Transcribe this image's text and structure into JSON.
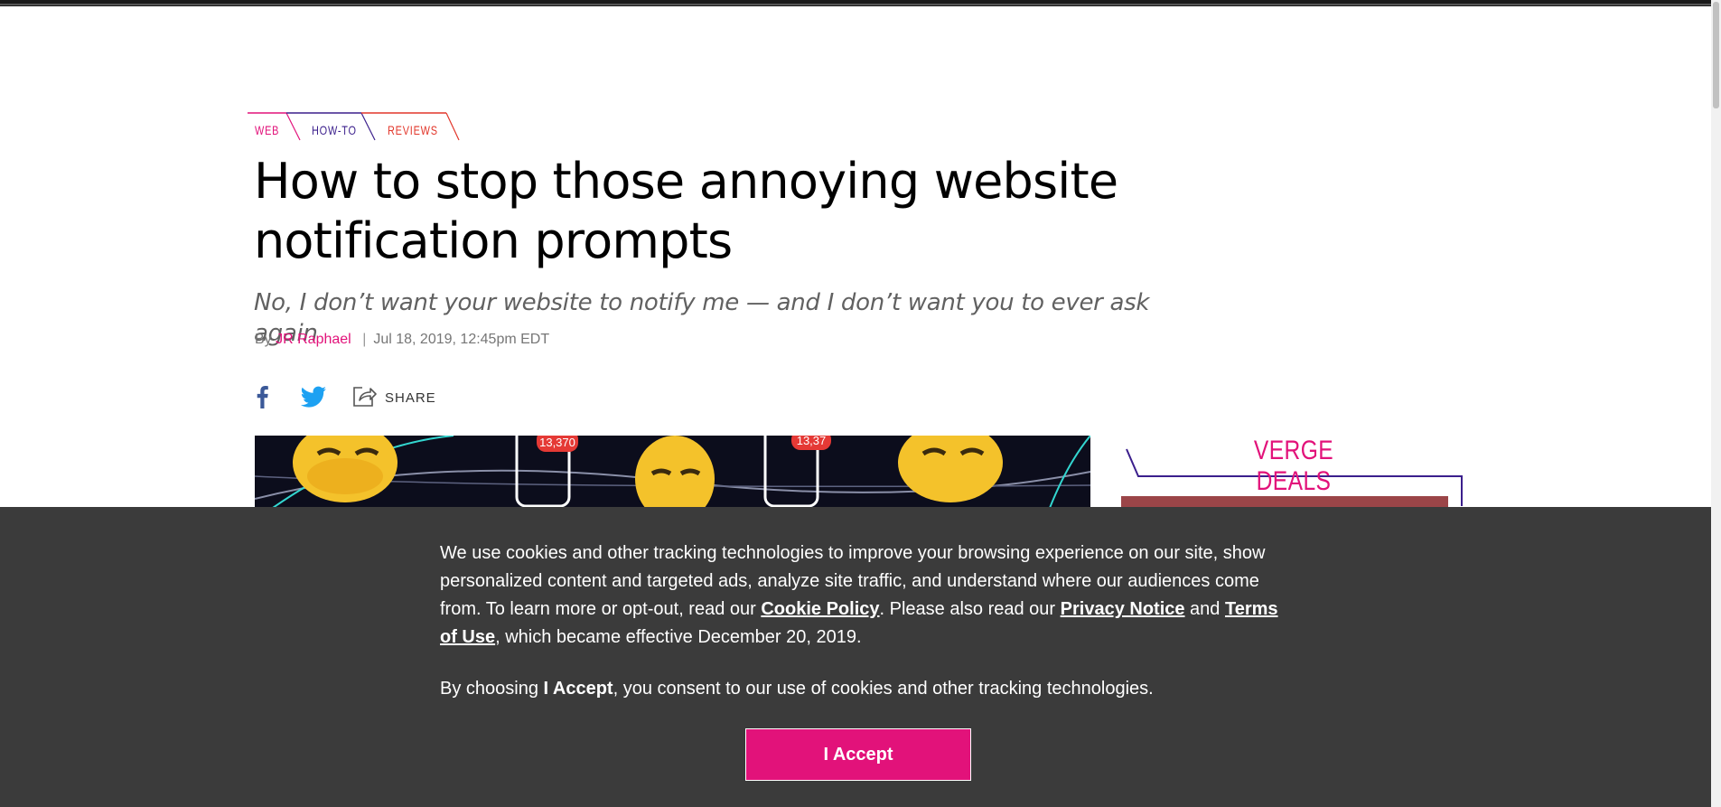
{
  "article": {
    "tags": [
      "WEB",
      "HOW-TO",
      "REVIEWS"
    ],
    "tag_colors": [
      "#e2127a",
      "#3b1f8c",
      "#e2362a"
    ],
    "headline_line1": "How to stop those annoying website",
    "headline_line2": "notification prompts",
    "dek": "No, I don’t want your website to notify me — and I don’t want you to ever ask again",
    "byline_prefix": "By",
    "author": "JR Raphael",
    "separator": "|",
    "date": "Jul 18, 2019, 12:45pm EDT"
  },
  "social": {
    "facebook_icon": "facebook-icon",
    "twitter_icon": "twitter-icon",
    "share_icon": "share-icon",
    "share_label": "SHARE"
  },
  "hero": {
    "badge_1": "13,370",
    "badge_2": "13,37"
  },
  "sidebar": {
    "deals_title": "VERGE DEALS"
  },
  "cookie_banner": {
    "text_1": "We use cookies and other tracking technologies to improve your browsing experience on our site, show personalized content and targeted ads, analyze site traffic, and understand where our audiences come from. To learn more or opt-out, read our ",
    "cookie_policy_link": "Cookie Policy",
    "text_2": ". Please also read our ",
    "privacy_link": "Privacy Notice",
    "text_3": " and ",
    "terms_link": "Terms of Use",
    "text_4": ", which became effective December 20, 2019.",
    "consent_prefix": "By choosing ",
    "consent_bold": "I Accept",
    "consent_suffix": ", you consent to our use of cookies and other tracking technologies.",
    "accept_label": "I Accept"
  },
  "colors": {
    "accent": "#e2127a",
    "overlay": "#3b3b3b"
  }
}
